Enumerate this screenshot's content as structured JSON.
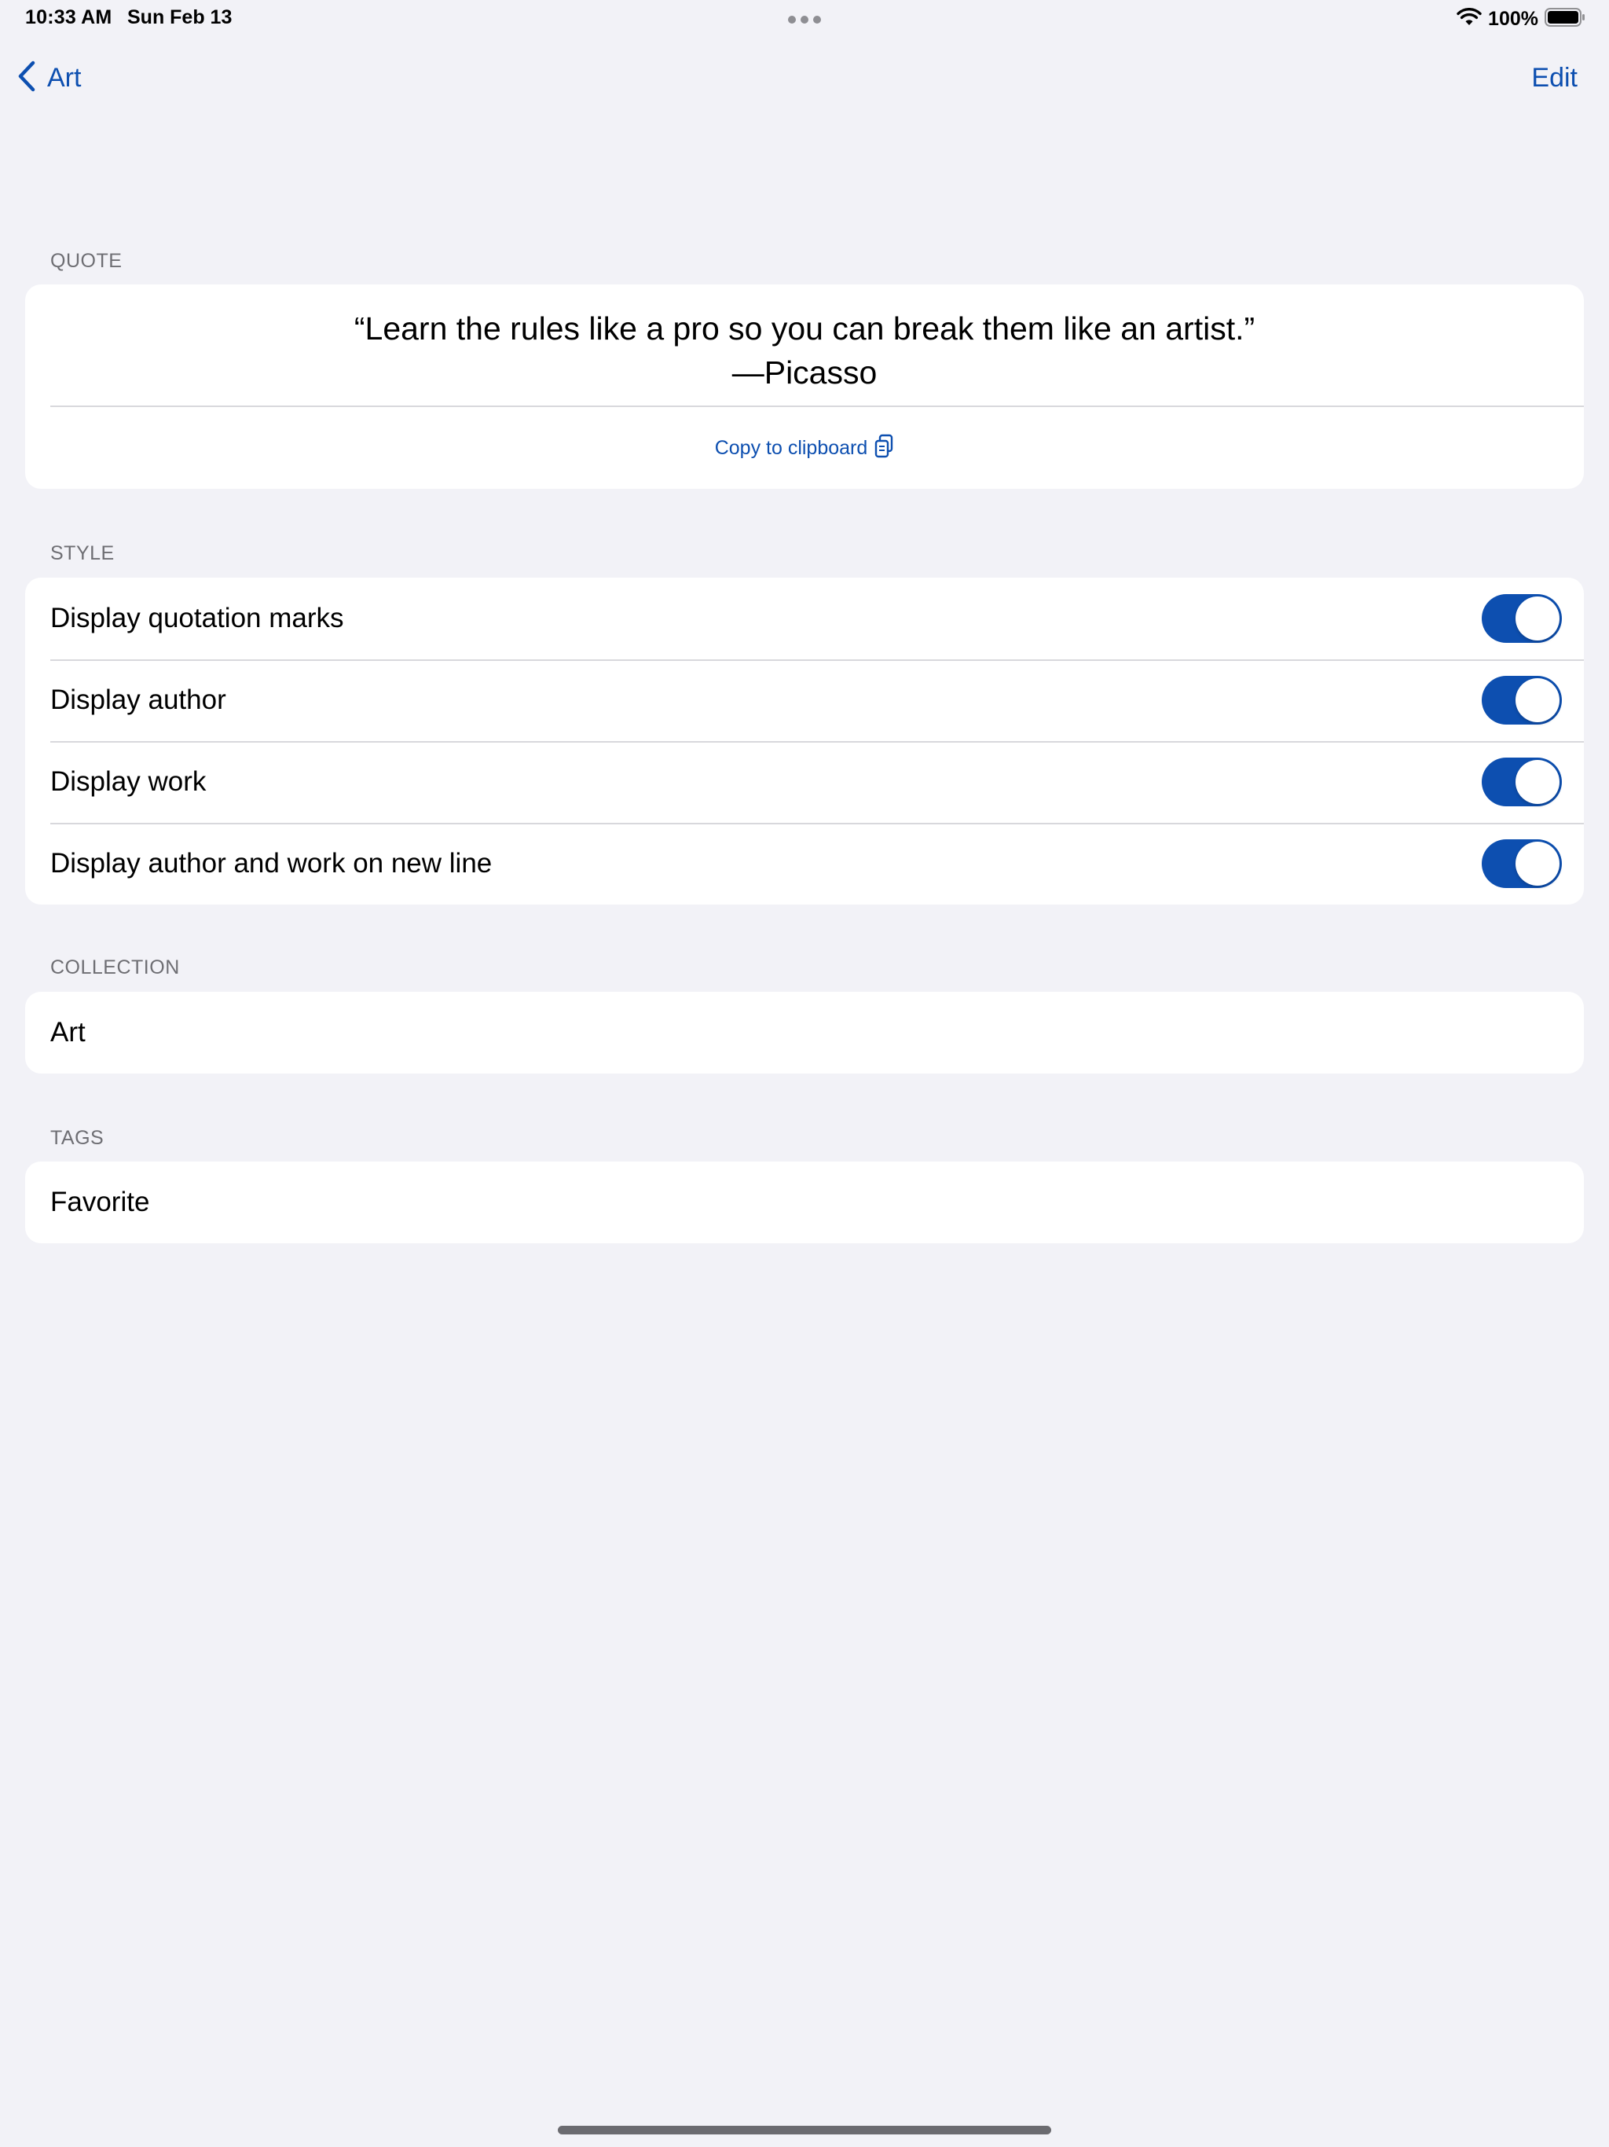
{
  "status_bar": {
    "time": "10:33 AM",
    "date": "Sun Feb 13",
    "battery": "100%"
  },
  "nav": {
    "back_label": "Art",
    "edit_label": "Edit"
  },
  "quote_section": {
    "header": "QUOTE",
    "quote_line": "“Learn the rules like a pro so you can break them like an artist.”",
    "author_line": "—Picasso",
    "copy_label": "Copy to clipboard"
  },
  "style_section": {
    "header": "STYLE",
    "options": [
      {
        "label": "Display quotation marks",
        "enabled": true
      },
      {
        "label": "Display author",
        "enabled": true
      },
      {
        "label": "Display work",
        "enabled": true
      },
      {
        "label": "Display author and work on new line",
        "enabled": true
      }
    ]
  },
  "collection_section": {
    "header": "COLLECTION",
    "value": "Art"
  },
  "tags_section": {
    "header": "TAGS",
    "value": "Favorite"
  },
  "colors": {
    "accent": "#0d4fb0",
    "background": "#f2f2f7",
    "card": "#ffffff",
    "secondary_text": "#6e6e73"
  }
}
